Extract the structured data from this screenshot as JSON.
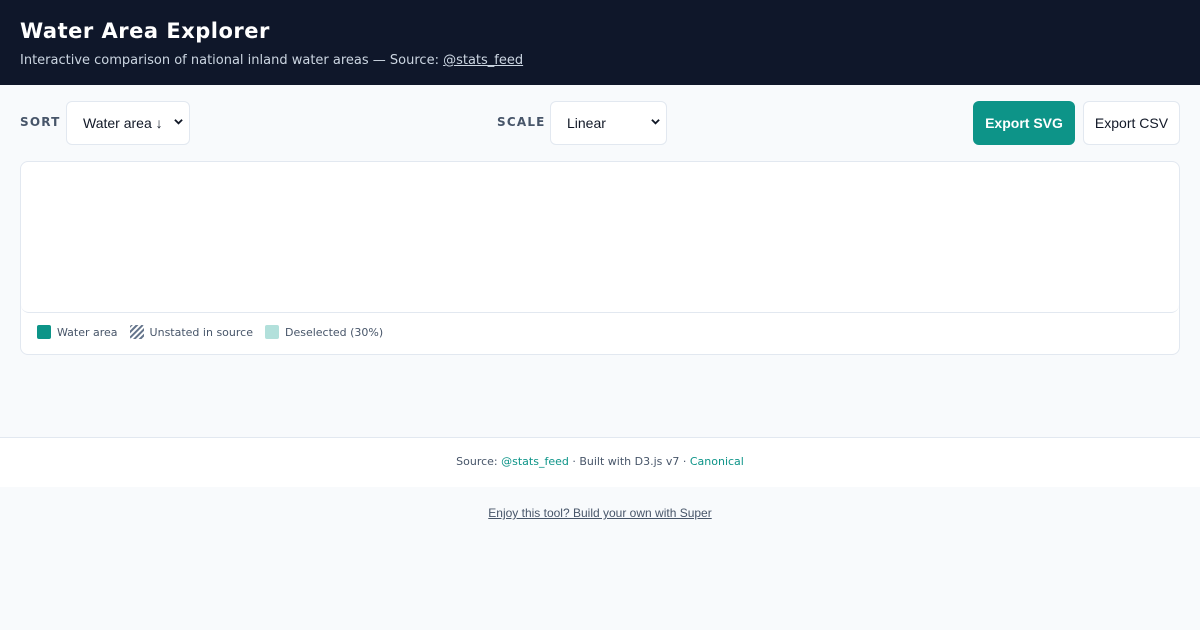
{
  "header": {
    "title": "Water Area Explorer",
    "subtitle_prefix": "Interactive comparison of national inland water areas — Source: ",
    "source_link": "@stats_feed"
  },
  "controls": {
    "sort_label": "SORT",
    "sort_value": "Water area ↓",
    "scale_label": "SCALE",
    "scale_value": "Linear",
    "export_svg": "Export SVG",
    "export_csv": "Export CSV"
  },
  "legend": {
    "items": [
      {
        "label": "Water area",
        "color": "#0d9488"
      },
      {
        "label": "Unstated in source",
        "color": "hatched"
      },
      {
        "label": "Deselected (30%)",
        "color": "#b2e0db"
      }
    ]
  },
  "footer": {
    "prefix": "Source: ",
    "source_link": "@stats_feed",
    "middle": " · Built with D3.js v7 · ",
    "canonical_link": "Canonical"
  },
  "promo": {
    "text": "Enjoy this tool? Build your own with Super"
  },
  "colors": {
    "header_bg": "#0f172a",
    "accent": "#0d9488",
    "page_bg": "#f8fafc"
  }
}
